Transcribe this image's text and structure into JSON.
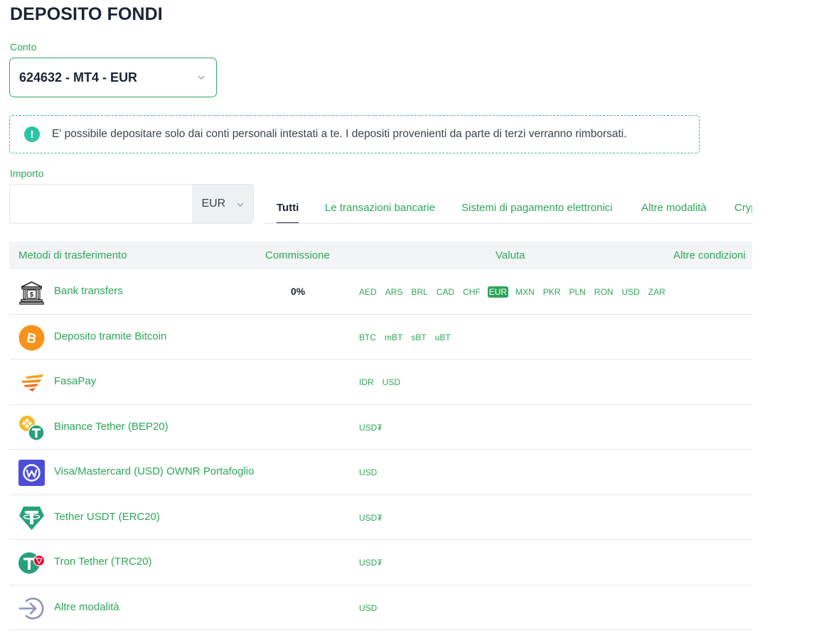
{
  "page": {
    "title": "DEPOSITO FONDI"
  },
  "conto": {
    "label": "Conto",
    "value": "624632 - MT4 - EUR"
  },
  "notice": {
    "text": "E' possibile depositare solo dai conti personali intestati a te. I depositi provenienti da parte di terzi verranno rimborsati."
  },
  "importo": {
    "label": "Importo",
    "value": "",
    "currency": "EUR"
  },
  "tabs": [
    {
      "label": "Tutti",
      "active": true
    },
    {
      "label": "Le transazioni bancarie"
    },
    {
      "label": "Sistemi di pagamento elettronici"
    },
    {
      "label": "Altre modalità"
    },
    {
      "label": "Crypto"
    }
  ],
  "table": {
    "headers": [
      "Metodi di trasferimento",
      "Commissione",
      "Valuta",
      "Altre condizioni"
    ],
    "rows": [
      {
        "name": "Bank transfers",
        "icon": "bank-icon",
        "commission": "0%",
        "currencies": [
          "AED",
          "ARS",
          "BRL",
          "CAD",
          "CHF",
          "EUR",
          "MXN",
          "PKR",
          "PLN",
          "RON",
          "USD",
          "ZAR"
        ],
        "selected": "EUR"
      },
      {
        "name": "Deposito tramite Bitcoin",
        "icon": "bitcoin-icon",
        "commission": "",
        "currencies": [
          "BTC",
          "mBT",
          "sBT",
          "uBT"
        ]
      },
      {
        "name": "FasaPay",
        "icon": "fasapay-icon",
        "commission": "",
        "currencies": [
          "IDR",
          "USD"
        ]
      },
      {
        "name": "Binance Tether (BEP20)",
        "icon": "binance-tether-icon",
        "commission": "",
        "currencies": [
          "USD₮"
        ]
      },
      {
        "name": "Visa/Mastercard (USD) OWNR Portafoglio",
        "icon": "ownr-wallet-icon",
        "commission": "",
        "currencies": [
          "USD"
        ]
      },
      {
        "name": "Tether USDT (ERC20)",
        "icon": "tether-icon",
        "commission": "",
        "currencies": [
          "USD₮"
        ]
      },
      {
        "name": "Tron Tether (TRC20)",
        "icon": "tron-tether-icon",
        "commission": "",
        "currencies": [
          "USD₮"
        ]
      },
      {
        "name": "Altre modalità",
        "icon": "arrow-in-icon",
        "commission": "",
        "currencies": [
          "USD"
        ]
      }
    ]
  },
  "colors": {
    "accent": "#2ea65a",
    "heading": "#1c2434",
    "notice_icon": "#2ec4a6",
    "header_bg": "#f2f4f6"
  }
}
